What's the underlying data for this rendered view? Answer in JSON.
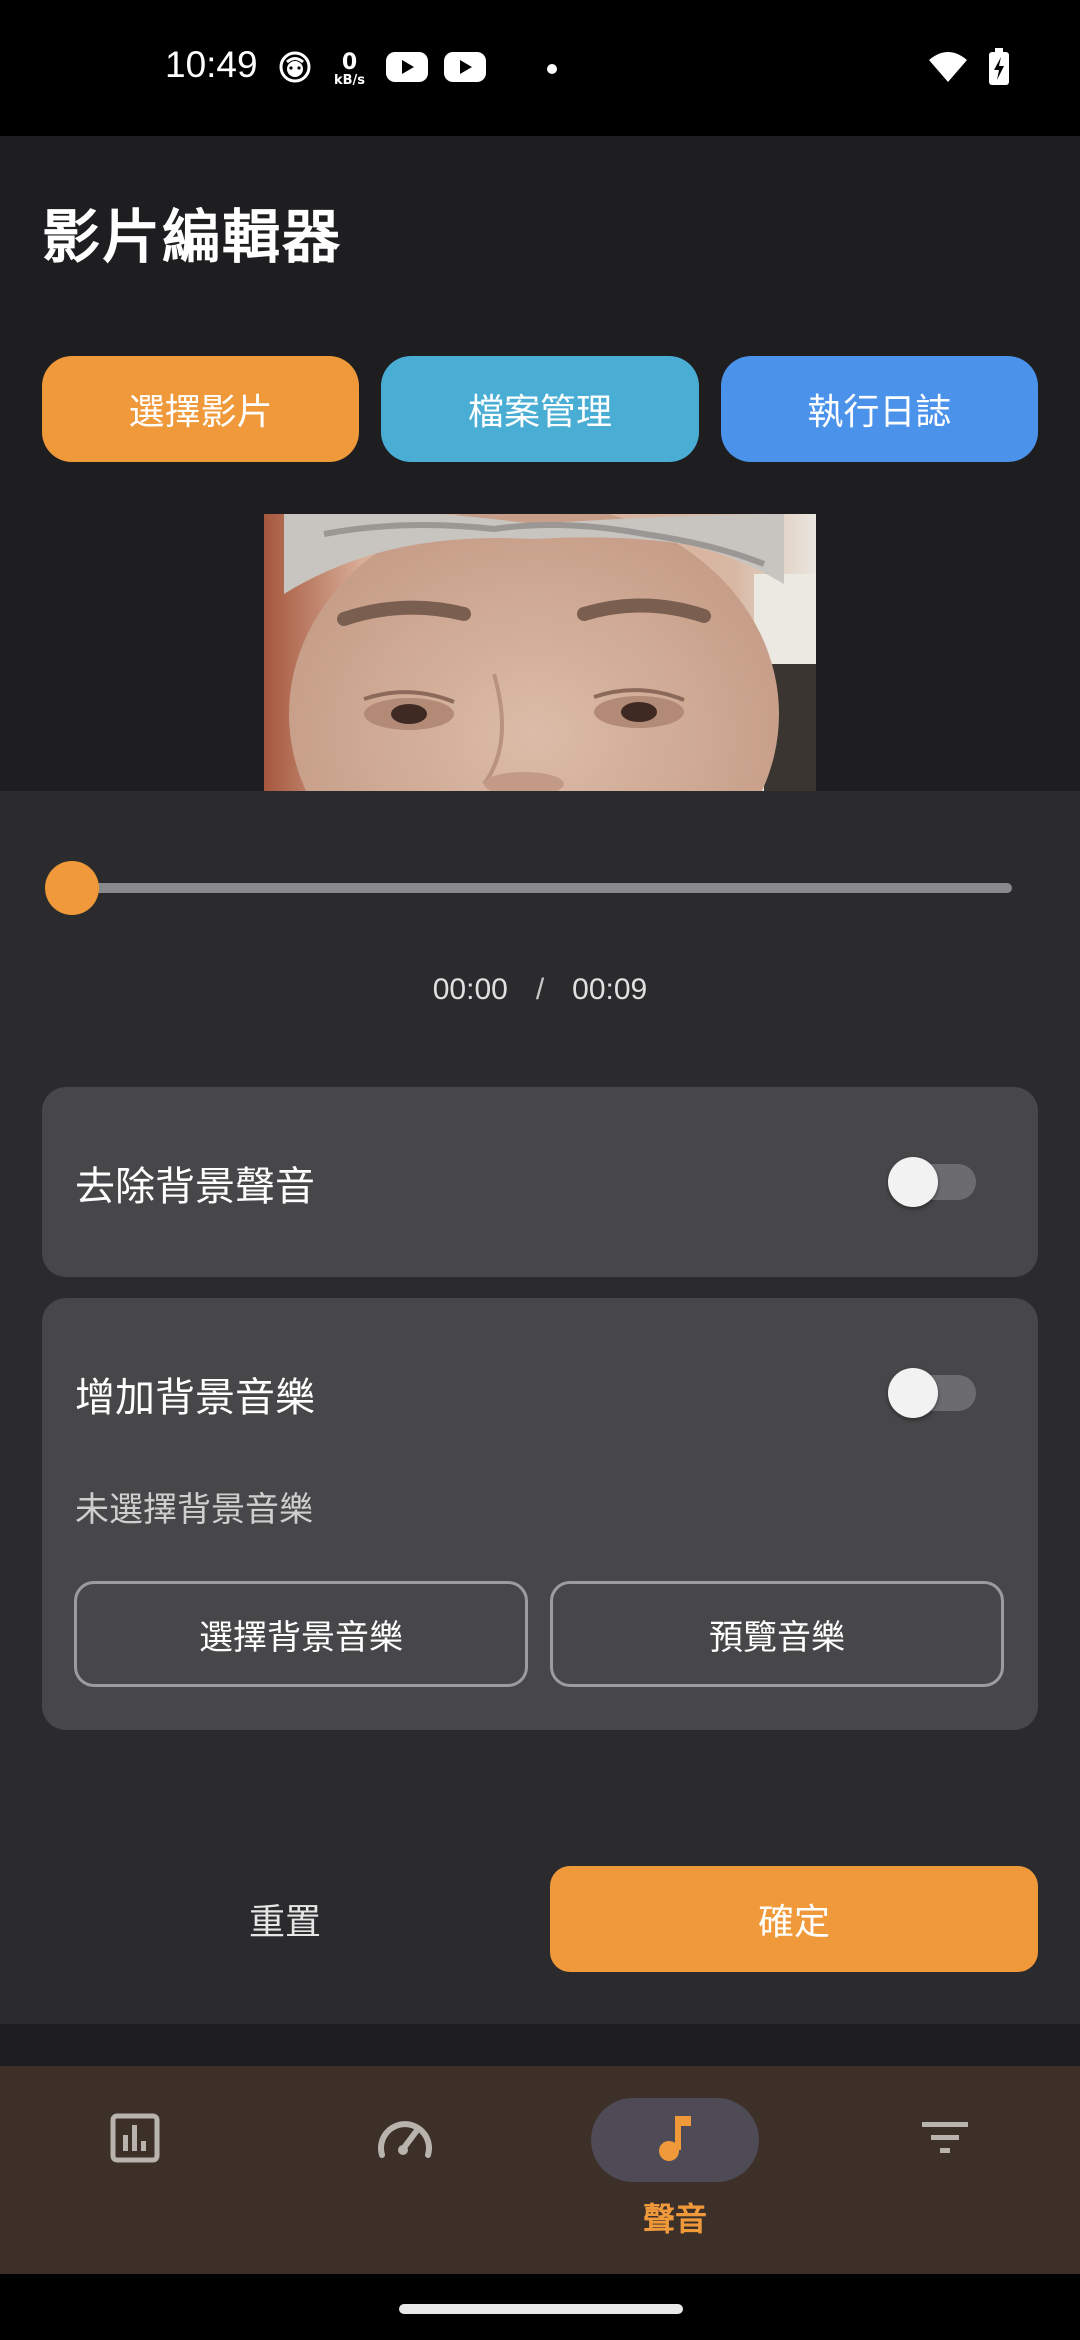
{
  "status_bar": {
    "time": "10:49",
    "net_speed_value": "0",
    "net_speed_unit": "kB/s",
    "icons": [
      "face-notification-icon",
      "youtube-icon",
      "youtube-icon",
      "dot-icon",
      "wifi-icon",
      "battery-charging-icon"
    ]
  },
  "header": {
    "title": "影片編輯器"
  },
  "actions": {
    "select_video": "選擇影片",
    "file_manager": "檔案管理",
    "execution_log": "執行日誌"
  },
  "player": {
    "current_time": "00:00",
    "separator": "/",
    "total_time": "00:09",
    "progress_fraction": 0.0
  },
  "audio_options": {
    "remove_bg_sound": {
      "label": "去除背景聲音",
      "enabled": false
    },
    "add_bg_music": {
      "label": "增加背景音樂",
      "enabled": false,
      "status": "未選擇背景音樂",
      "choose_label": "選擇背景音樂",
      "preview_label": "預覽音樂"
    }
  },
  "footer": {
    "reset_label": "重置",
    "confirm_label": "確定"
  },
  "bottom_nav": {
    "items": [
      {
        "icon": "bar-chart-icon",
        "label": ""
      },
      {
        "icon": "speedometer-icon",
        "label": ""
      },
      {
        "icon": "music-note-icon",
        "label": "聲音",
        "active": true
      },
      {
        "icon": "filter-icon",
        "label": ""
      }
    ]
  },
  "colors": {
    "accent_orange": "#f0993a",
    "cyan": "#4aaed4",
    "blue": "#4a92ea",
    "card": "#474749",
    "sheet": "#2b2b2e",
    "nav_bg": "#3c3029"
  }
}
